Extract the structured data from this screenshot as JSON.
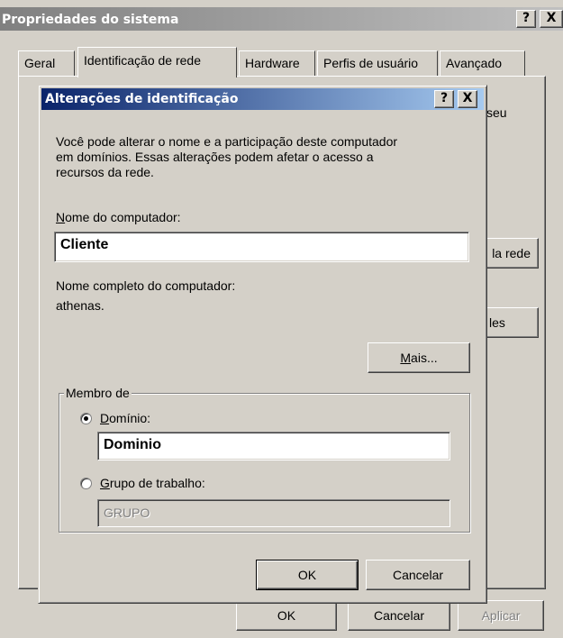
{
  "window": {
    "title": "Propriedades do sistema",
    "help_glyph": "?",
    "close_glyph": "X"
  },
  "tabs": [
    {
      "label": "Geral"
    },
    {
      "label": "Identificação de rede"
    },
    {
      "label": "Hardware"
    },
    {
      "label": "Perfis de usuário"
    },
    {
      "label": "Avançado"
    }
  ],
  "background_panel": {
    "partial_text": "seu",
    "partial_button_1": "la rede",
    "partial_button_2": "les"
  },
  "bottom_buttons": {
    "ok": "OK",
    "cancel": "Cancelar",
    "apply": "Aplicar"
  },
  "dialog": {
    "title": "Alterações de identificação",
    "help_glyph": "?",
    "close_glyph": "X",
    "description_lines": [
      "Você pode alterar o nome e a participação deste computador",
      "em domínios. Essas alterações podem afetar o acesso a",
      "recursos da rede."
    ],
    "computer_name": {
      "label_underlined": "N",
      "label_rest": "ome do computador:",
      "value": "Cliente"
    },
    "full_name": {
      "label": "Nome completo do computador:",
      "value": "athenas."
    },
    "more_button": {
      "underlined": "M",
      "rest": "ais..."
    },
    "member_of": {
      "label": "Membro de",
      "domain": {
        "underlined": "D",
        "rest": "omínio:",
        "value": "Dominio",
        "selected": true
      },
      "workgroup": {
        "underlined": "G",
        "rest": "rupo de trabalho:",
        "value": "GRUPO",
        "selected": false
      }
    },
    "ok_label": "OK",
    "cancel_label": "Cancelar"
  }
}
